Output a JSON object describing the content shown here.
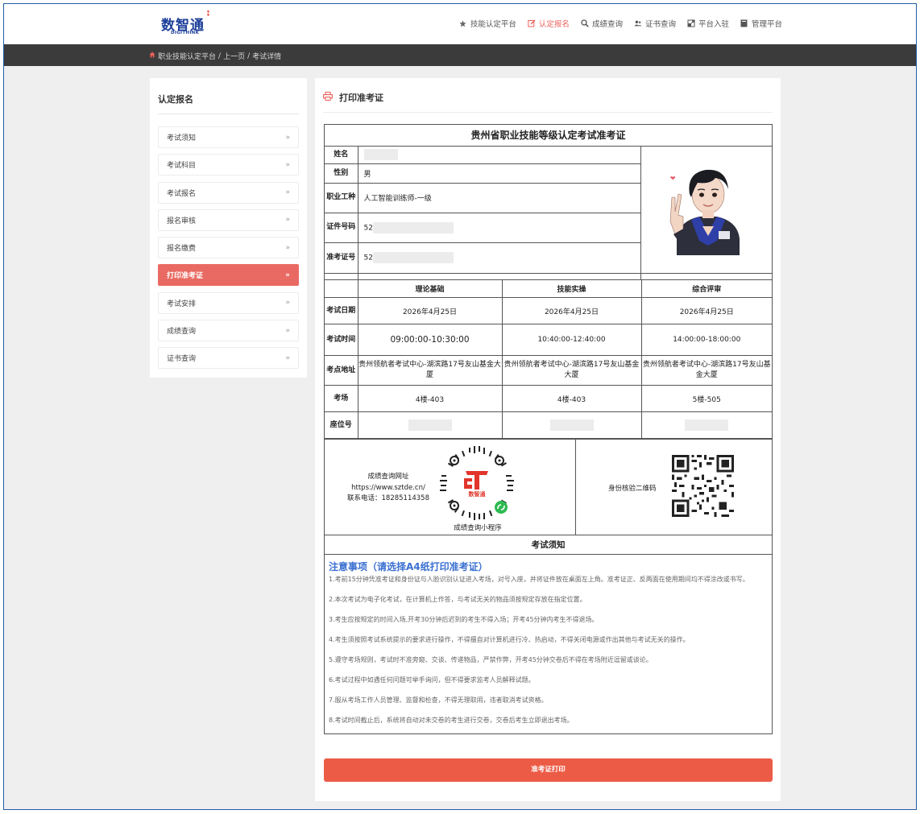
{
  "header": {
    "logo_cn": "数智通",
    "logo_en": "DIGITHINK",
    "nav": [
      {
        "icon": "star-icon",
        "label": "技能认定平台",
        "active": false
      },
      {
        "icon": "edit-icon",
        "label": "认定报名",
        "active": true
      },
      {
        "icon": "search-icon",
        "label": "成绩查询",
        "active": false
      },
      {
        "icon": "users-icon",
        "label": "证书查询",
        "active": false
      },
      {
        "icon": "enter-icon",
        "label": "平台入驻",
        "active": false
      },
      {
        "icon": "book-icon",
        "label": "管理平台",
        "active": false
      }
    ]
  },
  "breadcrumb": {
    "home": "职业技能认定平台",
    "sep1": "/",
    "back": "上一页",
    "sep2": "/",
    "current": "考试详情"
  },
  "sidebar": {
    "title": "认定报名",
    "items": [
      {
        "label": "考试须知",
        "active": false
      },
      {
        "label": "考试科目",
        "active": false
      },
      {
        "label": "考试报名",
        "active": false
      },
      {
        "label": "报名审核",
        "active": false
      },
      {
        "label": "报名缴费",
        "active": false
      },
      {
        "label": "打印准考证",
        "active": true
      },
      {
        "label": "考试安排",
        "active": false
      },
      {
        "label": "成绩查询",
        "active": false
      },
      {
        "label": "证书查询",
        "active": false
      }
    ]
  },
  "main": {
    "title": "打印准考证",
    "ticket": {
      "title": "贵州省职业技能等级认定考试准考证",
      "fields": {
        "name_label": "姓名",
        "name_value": "",
        "gender_label": "性别",
        "gender_value": "男",
        "job_label": "职业工种",
        "job_value": "人工智能训练师-一级",
        "id_label": "证件号码",
        "id_value": "52",
        "ticket_no_label": "准考证号",
        "ticket_no_value": "52"
      },
      "schedule": {
        "columns": [
          "理论基础",
          "技能实操",
          "综合评审"
        ],
        "rows": [
          {
            "label": "考试日期",
            "values": [
              "2026年4月25日",
              "2026年4月25日",
              "2026年4月25日"
            ]
          },
          {
            "label": "考试时间",
            "values": [
              "09:00:00-10:30:00",
              "10:40:00-12:40:00",
              "14:00:00-18:00:00"
            ]
          },
          {
            "label": "考点地址",
            "values": [
              "贵州领航者考试中心-湖滨路17号友山基金大厦",
              "贵州领航者考试中心-湖滨路17号友山基金大厦",
              "贵州领航者考试中心-湖滨路17号友山基金大厦"
            ]
          },
          {
            "label": "考场",
            "values": [
              "4楼-403",
              "4楼-403",
              "5楼-505"
            ]
          },
          {
            "label": "座位号",
            "values": [
              "",
              "",
              ""
            ]
          }
        ]
      },
      "query": {
        "line1": "成绩查询网址",
        "line2": "https://www.sztde.cn/",
        "line3": "联系电话：18285114358",
        "mini_caption": "成绩查询小程序",
        "verify_label": "身份核验二维码"
      },
      "notice": {
        "title": "考试须知",
        "heading": "注意事项（请选择A4纸打印准考证）",
        "items": [
          "1.考前15分钟凭准考证和身份证与人脸识别认证进入考场，对号入座，并将证件放在桌面左上角。准考证正、反两面在使用期间均不得涂改或书写。",
          "2.本次考试为电子化考试，在计算机上作答，与考试无关的物品须按规定存放在指定位置。",
          "3.考生应按规定的时间入场,开考30分钟后迟到的考生不得入场；开考45分钟内考生不得退场。",
          "4.考生须按照考试系统提示的要求进行操作，不得擅自对计算机进行冷、热启动，不得关闭电源或作出其他与考试无关的操作。",
          "5.遵守考场规则，考试时不准旁窥、交谈、传递物品，严禁作弊，开考45分钟交卷后不得在考场附近逗留或谈论。",
          "6.考试过程中如遇任何问题可举手询问，但不得要求监考人员解释试题。",
          "7.服从考场工作人员管理、监督和检查，不得无理取闹，违者取消考试资格。",
          "8.考试时间截止后，系统将自动对未交卷的考生进行交卷，交卷后考生立即退出考场。"
        ]
      }
    },
    "print_button": "准考证打印"
  },
  "colors": {
    "accent": "#e9605a",
    "button": "#ec5b45",
    "notice_heading": "#3a6fd1",
    "breadcrumb_bg": "#3b3b3b"
  }
}
